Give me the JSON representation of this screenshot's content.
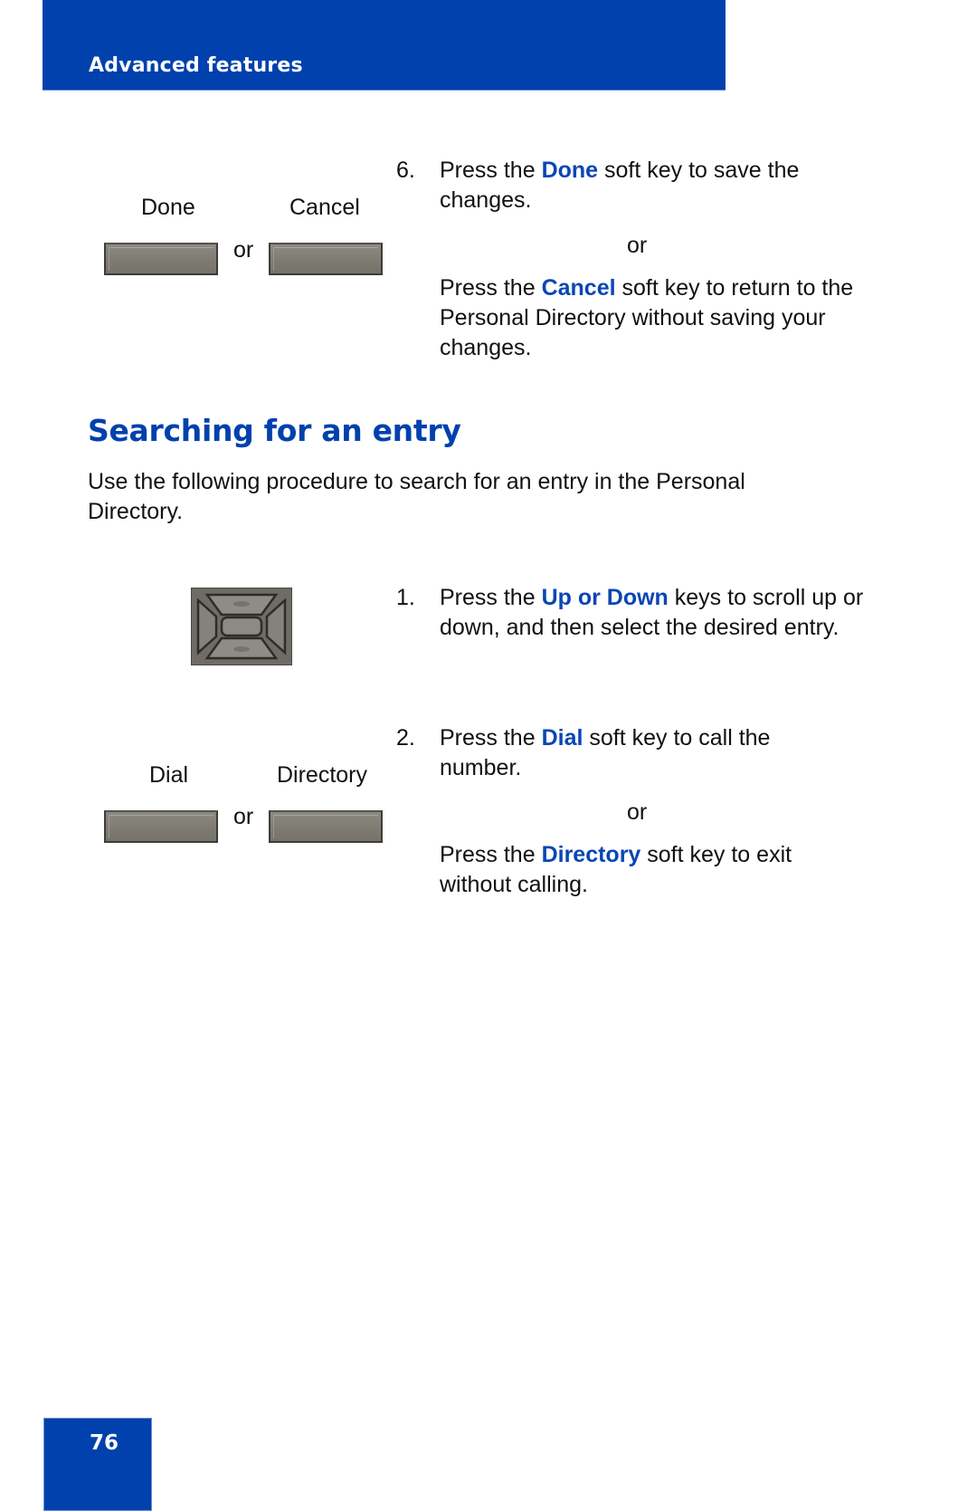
{
  "header": {
    "title": "Advanced features"
  },
  "step6": {
    "softkeys": [
      {
        "label": "Done"
      },
      {
        "label": "Cancel"
      }
    ],
    "or_between_keys": "or",
    "number": "6.",
    "line1_pre": "Press the ",
    "line1_key": "Done",
    "line1_post": " soft key to save the changes.",
    "or_text": "or",
    "line2_pre": "Press the ",
    "line2_key": "Cancel",
    "line2_post": " soft key to return to the Personal Directory without saving your changes."
  },
  "section": {
    "title": "Searching for an entry",
    "intro": "Use the following procedure to search for an entry in the Personal Directory."
  },
  "step1": {
    "icon": "navigation-cluster-icon",
    "number": "1.",
    "pre": "Press the ",
    "key": "Up or Down",
    "post": " keys to scroll up or down, and then select the desired entry."
  },
  "step2": {
    "softkeys": [
      {
        "label": "Dial"
      },
      {
        "label": "Directory"
      }
    ],
    "or_between_keys": "or",
    "number": "2.",
    "line1_pre": "Press the ",
    "line1_key": "Dial",
    "line1_post": " soft key to call the number.",
    "or_text": "or",
    "line2_pre": "Press the ",
    "line2_key": "Directory",
    "line2_post": " soft key to exit without calling."
  },
  "footer": {
    "page_number": "76"
  },
  "colors": {
    "brand_blue": "#0041ad",
    "highlight_blue": "#0a46b4",
    "softkey_gray": "#807d75"
  }
}
